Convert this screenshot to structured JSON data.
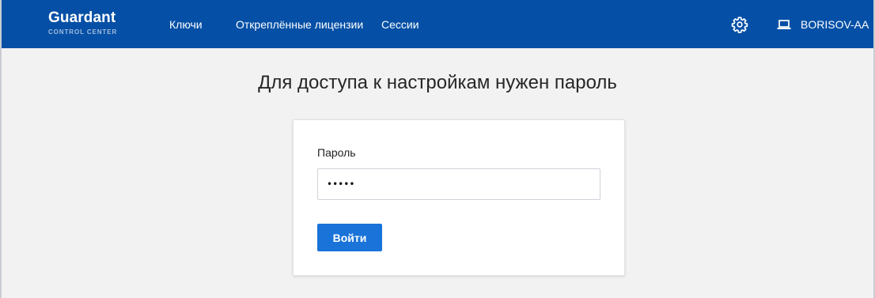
{
  "header": {
    "logo_title": "Guardant",
    "logo_subtitle": "CONTROL CENTER",
    "nav": {
      "keys": "Ключи",
      "detached_licenses": "Откреплённые лицензии",
      "sessions": "Сессии"
    },
    "settings_icon": "gear-icon",
    "user_icon": "laptop-icon",
    "user_name": "BORISOV-AA",
    "background_color": "#0550a6"
  },
  "main": {
    "title": "Для доступа к настройкам нужен пароль",
    "form": {
      "password_label": "Пароль",
      "password_value": "•••••",
      "submit_label": "Войти",
      "submit_color": "#1a73d9"
    }
  }
}
